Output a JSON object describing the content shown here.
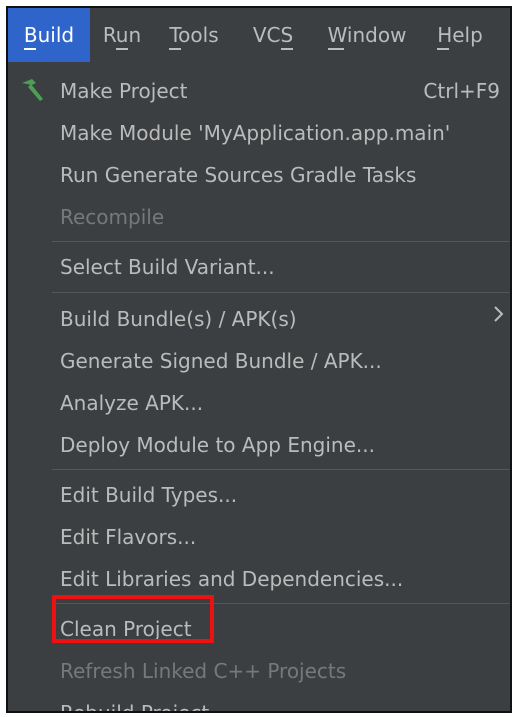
{
  "menubar": {
    "items": [
      "Build",
      "Run",
      "Tools",
      "VCS",
      "Window",
      "Help"
    ]
  },
  "menu": {
    "make_project": {
      "label": "Make Project",
      "shortcut": "Ctrl+F9",
      "icon": "hammer-icon"
    },
    "make_module": {
      "label": "Make Module 'MyApplication.app.main'"
    },
    "run_generate_sources": {
      "label": "Run Generate Sources Gradle Tasks"
    },
    "recompile": {
      "label": "Recompile"
    },
    "select_build_variant": {
      "label": "Select Build Variant..."
    },
    "build_bundle_apk": {
      "label": "Build Bundle(s) / APK(s)",
      "icon": "chevron-right-icon"
    },
    "generate_signed_bundle": {
      "label": "Generate Signed Bundle / APK..."
    },
    "analyze_apk": {
      "label": "Analyze APK..."
    },
    "deploy_module": {
      "label": "Deploy Module to App Engine..."
    },
    "edit_build_types": {
      "label": "Edit Build Types..."
    },
    "edit_flavors": {
      "label": "Edit Flavors..."
    },
    "edit_libraries": {
      "label": "Edit Libraries and Dependencies..."
    },
    "clean_project": {
      "label": "Clean Project"
    },
    "refresh_linked_cpp": {
      "label": "Refresh Linked C++ Projects"
    },
    "rebuild_project": {
      "label": "Rebuild Project"
    }
  },
  "colors": {
    "menu_bg": "#3c3f41",
    "active_bg": "#2f65ca",
    "text": "#bbbbbb",
    "disabled_text": "#767879",
    "highlight_border": "#ee1111",
    "hammer": "#4f9e55"
  }
}
